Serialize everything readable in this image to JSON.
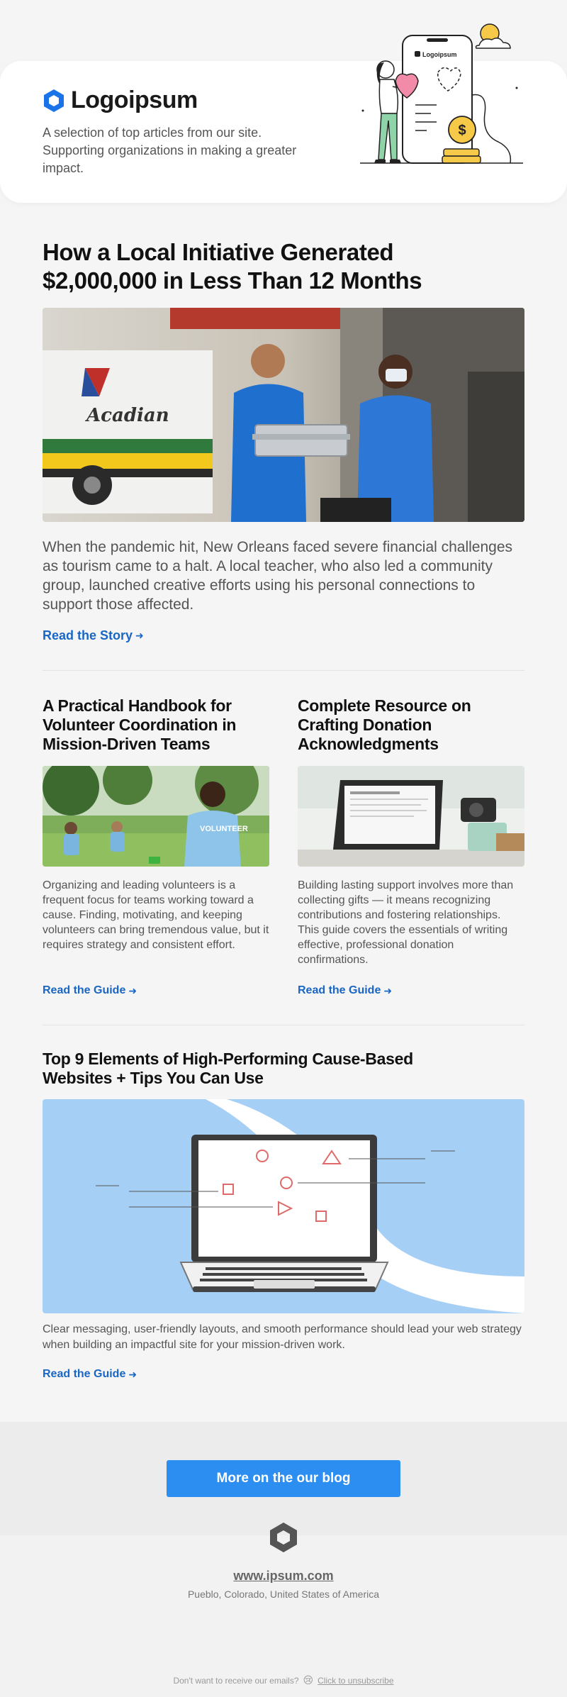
{
  "brand": {
    "name": "Logoipsum",
    "tagline": "A selection of top articles from our site. Supporting organizations in making a greater impact."
  },
  "featured": {
    "title": "How a Local Initiative Generated $2,000,000 in Less Than 12 Months",
    "description": "When the pandemic hit, New Orleans faced severe financial challenges as tourism came to a halt. A local teacher, who also led a community group, launched creative efforts using his personal connections to support those affected.",
    "link_label": "Read the Story",
    "image_alt": "Two healthcare workers carrying supplies beside an ambulance",
    "ambulance_text": "Acadian"
  },
  "articles": [
    {
      "title": "A Practical Handbook for Volunteer Coordination in Mission-Driven Teams",
      "description": "Organizing and leading volunteers is a frequent focus for teams working toward a cause. Finding, motivating, and keeping volunteers can bring tremendous value, but it requires strategy and consistent effort.",
      "link_label": "Read the Guide",
      "image_alt": "Volunteers working outdoors in a park",
      "shirt_text": "VOLUNTEER"
    },
    {
      "title": "Complete Resource on Crafting Donation Acknowledgments",
      "description": "Building lasting support involves more than collecting gifts — it means recognizing contributions and fostering relationships. This guide covers the essentials of writing effective, professional donation confirmations.",
      "link_label": "Read the Guide",
      "image_alt": "Tablet on a desk with a camera and a mug"
    },
    {
      "title": "Top 9 Elements of High-Performing Cause-Based Websites + Tips You Can Use",
      "description": "Clear messaging, user-friendly layouts, and smooth performance should lead your web strategy when building an impactful site for your mission-driven work.",
      "link_label": "Read the Guide",
      "image_alt": "Illustration of a laptop with floating shapes"
    }
  ],
  "footer": {
    "cta_label": "More on the our blog",
    "site_url": "www.ipsum.com",
    "address": "Pueblo, Colorado, United States of America",
    "unsubscribe_prompt": "Don't want to receive our emails?",
    "unsubscribe_emoji": "😢",
    "unsubscribe_link": "Click to unsubscribe"
  },
  "colors": {
    "accent": "#2b8ef0",
    "link": "#1a66c4",
    "illustration_bg": "#a6cff5"
  },
  "icons": [
    "logoipsum-mark-icon",
    "arrow-right-icon",
    "crying-face-icon"
  ]
}
